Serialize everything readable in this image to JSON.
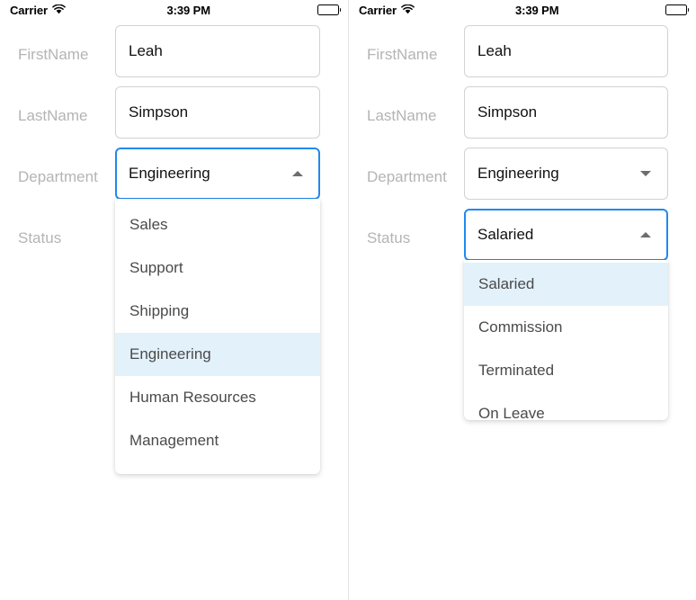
{
  "theme": {
    "accent_blue": "#2189f0",
    "highlight_blue": "#e3f1fb",
    "label_gray": "#b4b4b4",
    "border_gray": "#d2d2d2",
    "item_text_gray": "#4a4a4a",
    "divider_gray": "#e4e4e4"
  },
  "status_bar": {
    "carrier": "Carrier",
    "wifi_icon": "wifi-icon",
    "time": "3:39 PM",
    "battery_icon": "battery-full-icon"
  },
  "left_screen": {
    "first_name": {
      "label": "FirstName",
      "value": "Leah"
    },
    "last_name": {
      "label": "LastName",
      "value": "Simpson"
    },
    "department": {
      "label": "Department",
      "value": "Engineering",
      "expanded": true,
      "arrow_icon": "chevron-up-icon",
      "options": [
        "Sales",
        "Support",
        "Shipping",
        "Engineering",
        "Human Resources",
        "Management"
      ],
      "selected_index": 3
    },
    "status": {
      "label": "Status",
      "value": "",
      "expanded": false
    }
  },
  "right_screen": {
    "first_name": {
      "label": "FirstName",
      "value": "Leah"
    },
    "last_name": {
      "label": "LastName",
      "value": "Simpson"
    },
    "department": {
      "label": "Department",
      "value": "Engineering",
      "expanded": false,
      "arrow_icon": "chevron-down-icon"
    },
    "status": {
      "label": "Status",
      "value": "Salaried",
      "expanded": true,
      "arrow_icon": "chevron-up-icon",
      "options": [
        "Salaried",
        "Commission",
        "Terminated",
        "On Leave"
      ],
      "selected_index": 0
    }
  }
}
